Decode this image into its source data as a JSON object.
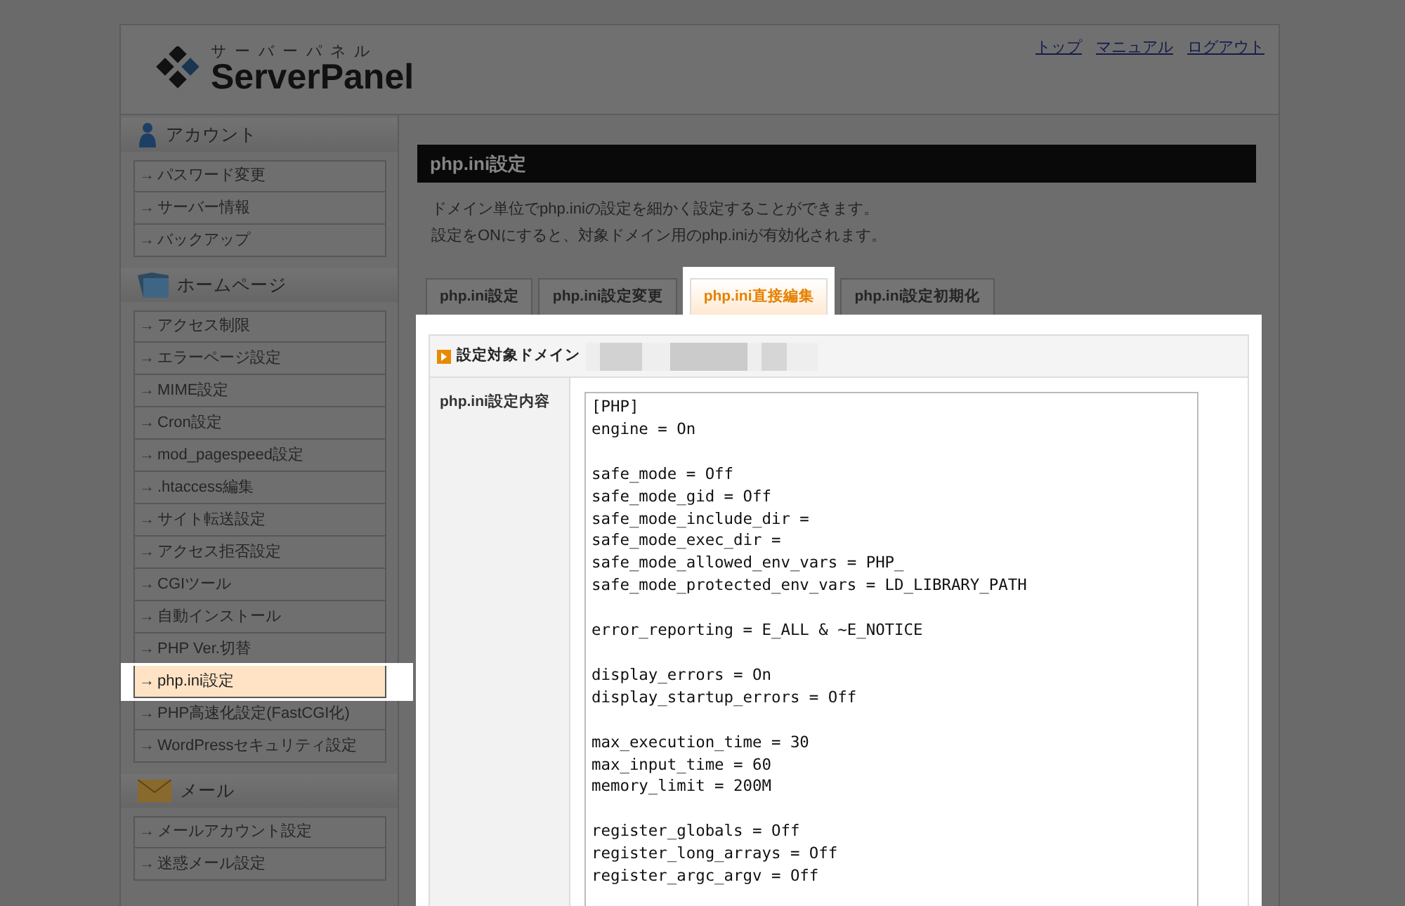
{
  "header": {
    "logo_kana": "サーバーパネル",
    "logo_text": "ServerPanel",
    "links": [
      "トップ",
      "マニュアル",
      "ログアウト"
    ]
  },
  "sidebar": {
    "arrow": "→",
    "sections": [
      {
        "title": "アカウント",
        "items": [
          {
            "label": "パスワード変更",
            "selected": false
          },
          {
            "label": "サーバー情報",
            "selected": false
          },
          {
            "label": "バックアップ",
            "selected": false
          }
        ]
      },
      {
        "title": "ホームページ",
        "items": [
          {
            "label": "アクセス制限",
            "selected": false
          },
          {
            "label": "エラーページ設定",
            "selected": false
          },
          {
            "label": "MIME設定",
            "selected": false
          },
          {
            "label": "Cron設定",
            "selected": false
          },
          {
            "label": "mod_pagespeed設定",
            "selected": false
          },
          {
            "label": ".htaccess編集",
            "selected": false
          },
          {
            "label": "サイト転送設定",
            "selected": false
          },
          {
            "label": "アクセス拒否設定",
            "selected": false
          },
          {
            "label": "CGIツール",
            "selected": false
          },
          {
            "label": "自動インストール",
            "selected": false
          },
          {
            "label": "PHP Ver.切替",
            "selected": false
          },
          {
            "label": "php.ini設定",
            "selected": true
          },
          {
            "label": "PHP高速化設定(FastCGI化)",
            "selected": false
          },
          {
            "label": "WordPressセキュリティ設定",
            "selected": false
          }
        ]
      },
      {
        "title": "メール",
        "items": [
          {
            "label": "メールアカウント設定",
            "selected": false
          },
          {
            "label": "迷惑メール設定",
            "selected": false
          }
        ]
      }
    ]
  },
  "main": {
    "title": "php.ini設定",
    "description": [
      "ドメイン単位でphp.iniの設定を細かく設定することができます。",
      "設定をONにすると、対象ドメイン用のphp.iniが有効化されます。"
    ],
    "tabs": [
      {
        "label": "php.ini設定",
        "selected": false
      },
      {
        "label": "php.ini設定変更",
        "selected": false
      },
      {
        "label": "php.ini直接編集",
        "selected": true
      },
      {
        "label": "php.ini設定初期化",
        "selected": false
      }
    ],
    "domain_label": "設定対象ドメイン",
    "content_label": "php.ini設定内容",
    "editor_blocks": [
      [
        "[PHP]",
        "engine = On"
      ],
      [
        "safe_mode = Off",
        "safe_mode_gid = Off",
        "safe_mode_include_dir =",
        "safe_mode_exec_dir =",
        "safe_mode_allowed_env_vars = PHP_",
        "safe_mode_protected_env_vars = LD_LIBRARY_PATH"
      ],
      [
        "error_reporting = E_ALL & ~E_NOTICE"
      ],
      [
        "display_errors = On",
        "display_startup_errors = Off"
      ],
      [
        "max_execution_time = 30",
        "max_input_time = 60",
        "memory_limit = 200M"
      ],
      [
        "register_globals = Off",
        "register_long_arrays = Off",
        "register_argc_argv = Off"
      ]
    ]
  }
}
